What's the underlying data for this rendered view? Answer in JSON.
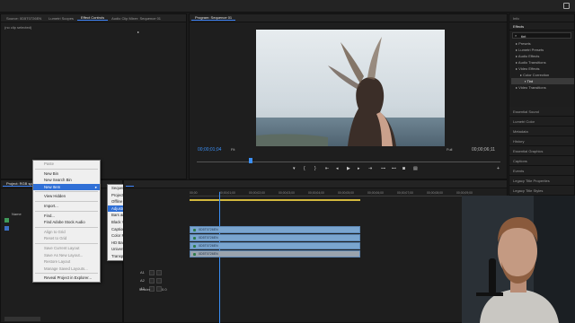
{
  "source_tabs": [
    "Source: 0D5T0726EN",
    "Lumetri Scopes",
    "Effect Controls",
    "Audio Clip Mixer: Sequence 01"
  ],
  "source_active_tab": 2,
  "effect_controls_empty": "(no clip selected)",
  "program_tab": "Program: Sequence 01",
  "program": {
    "timecode": "00;00;01;04",
    "fit": "Fit",
    "quality": "Full",
    "duration": "00;00;06;11"
  },
  "project_tab": "Project: RGB split",
  "project": {
    "name_header": "Name"
  },
  "context_menu": {
    "items": [
      {
        "label": "Paste",
        "disabled": true
      },
      {
        "sep": true
      },
      {
        "label": "New Bin"
      },
      {
        "label": "New Search Bin"
      },
      {
        "label": "New Item",
        "highlight": true,
        "submenu": true
      },
      {
        "sep": true
      },
      {
        "label": "View Hidden"
      },
      {
        "sep": true
      },
      {
        "label": "Import..."
      },
      {
        "sep": true
      },
      {
        "label": "Find..."
      },
      {
        "label": "Find Adobe Stock Audio"
      },
      {
        "sep": true
      },
      {
        "label": "Align to Grid",
        "disabled": true
      },
      {
        "label": "Reset to Grid",
        "disabled": true
      },
      {
        "sep": true
      },
      {
        "label": "Save Current Layout",
        "disabled": true
      },
      {
        "label": "Save As New Layout...",
        "disabled": true
      },
      {
        "label": "Restore Layout",
        "disabled": true
      },
      {
        "label": "Manage Saved Layouts...",
        "disabled": true
      },
      {
        "sep": true
      },
      {
        "label": "Reveal Project in Explorer..."
      }
    ]
  },
  "submenu": {
    "items": [
      {
        "label": "Sequence..."
      },
      {
        "label": "Project Shortcut..."
      },
      {
        "label": "Offline File..."
      },
      {
        "label": "Adjustment Layer...",
        "highlight": true
      },
      {
        "label": "Bars and Tone..."
      },
      {
        "label": "Black Video..."
      },
      {
        "label": "Captions..."
      },
      {
        "label": "Color Matte..."
      },
      {
        "label": "HD Bars and Tone..."
      },
      {
        "label": "Universal Counting Leader..."
      },
      {
        "label": "Transparent Video..."
      }
    ]
  },
  "timeline": {
    "ruler": [
      "00;00",
      "00;00;01;00",
      "00;00;02;00",
      "00;00;03;00",
      "00;00;04;00",
      "00;00;05;00",
      "00;00;06;00",
      "00;00;07;00",
      "00;00;08;00",
      "00;00;09;00"
    ],
    "clip_name": "0D5T0726EN",
    "track_labels": [
      "A1",
      "A2",
      "A3"
    ],
    "mix_label": "Master",
    "mix_value": "0.0"
  },
  "right_panel": {
    "info_tab": "Info",
    "effects_tab": "Effects",
    "search_value": "tint",
    "tree": [
      {
        "label": "Presets",
        "depth": 1
      },
      {
        "label": "Lumetri Presets",
        "depth": 1
      },
      {
        "label": "Audio Effects",
        "depth": 1
      },
      {
        "label": "Audio Transitions",
        "depth": 1
      },
      {
        "label": "Video Effects",
        "depth": 1
      },
      {
        "label": "Color Correction",
        "depth": 2
      },
      {
        "label": "Tint",
        "depth": 3,
        "selected": true
      },
      {
        "label": "Video Transitions",
        "depth": 1
      }
    ],
    "panels": [
      "Essential Sound",
      "Lumetri Color",
      "Metadata",
      "History",
      "Essential Graphics",
      "Captions",
      "Events",
      "Legacy Title Properties",
      "Legacy Title Styles"
    ]
  },
  "colors": {
    "accent": "#3b8ff5",
    "clip": "#7aa5cf",
    "playhead": "#3b8ff5"
  }
}
